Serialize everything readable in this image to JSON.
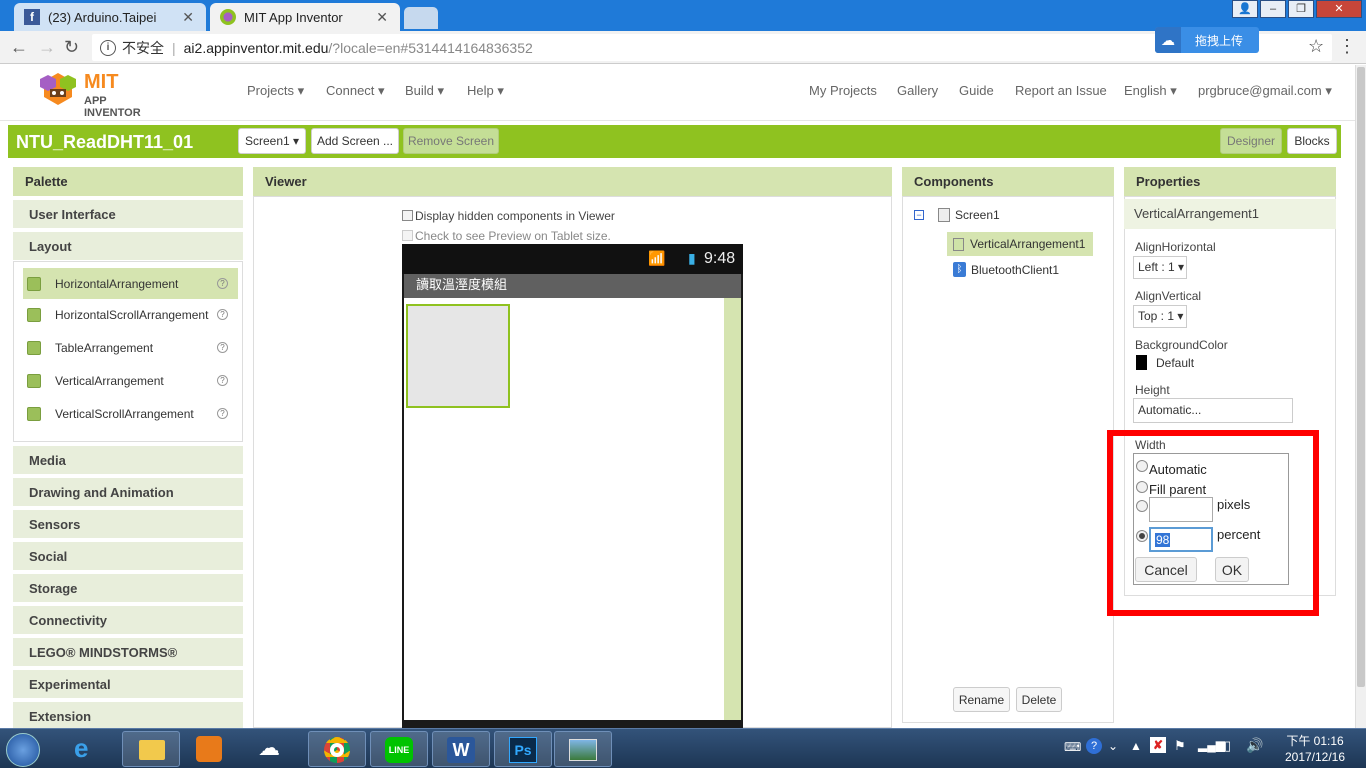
{
  "browser": {
    "tabs": [
      {
        "title": "(23) Arduino.Taipei"
      },
      {
        "title": "MIT App Inventor"
      }
    ],
    "insecure_label": "不安全",
    "url_host": "ai2.appinventor.mit.edu",
    "url_path": "/?locale=en#5314414164836352",
    "upload_button": "拖拽上传"
  },
  "topnav": {
    "logo_mit": "MIT",
    "logo_sub": "APP INVENTOR",
    "left_menu": [
      "Projects ▾",
      "Connect ▾",
      "Build ▾",
      "Help ▾"
    ],
    "right_menu": [
      "My Projects",
      "Gallery",
      "Guide",
      "Report an Issue",
      "English ▾",
      "prgbruce@gmail.com ▾"
    ]
  },
  "projectbar": {
    "name": "NTU_ReadDHT11_01",
    "screen_dropdown": "Screen1 ▾",
    "add_screen": "Add Screen ...",
    "remove_screen": "Remove Screen",
    "designer": "Designer",
    "blocks": "Blocks"
  },
  "palette": {
    "title": "Palette",
    "categories_top": [
      "User Interface",
      "Layout"
    ],
    "layout_items": [
      "HorizontalArrangement",
      "HorizontalScrollArrangement",
      "TableArrangement",
      "VerticalArrangement",
      "VerticalScrollArrangement"
    ],
    "categories_bottom": [
      "Media",
      "Drawing and Animation",
      "Sensors",
      "Social",
      "Storage",
      "Connectivity",
      "LEGO® MINDSTORMS®",
      "Experimental",
      "Extension"
    ]
  },
  "viewer": {
    "title": "Viewer",
    "display_hidden": "Display hidden components in Viewer",
    "tablet_preview": "Check to see Preview on Tablet size.",
    "phone_time": "9:48",
    "phone_title": "讀取溫溼度模組"
  },
  "components": {
    "title": "Components",
    "tree": [
      "Screen1",
      "VerticalArrangement1",
      "BluetoothClient1"
    ],
    "rename": "Rename",
    "delete": "Delete"
  },
  "properties": {
    "title": "Properties",
    "component": "VerticalArrangement1",
    "align_horizontal_label": "AlignHorizontal",
    "align_horizontal_value": "Left : 1 ▾",
    "align_vertical_label": "AlignVertical",
    "align_vertical_value": "Top : 1 ▾",
    "bg_color_label": "BackgroundColor",
    "bg_color_value": "Default",
    "height_label": "Height",
    "height_value": "Automatic...",
    "width_label": "Width"
  },
  "width_popup": {
    "automatic": "Automatic",
    "fill_parent": "Fill parent",
    "pixels": "pixels",
    "percent": "percent",
    "percent_value": "98",
    "selected_option": "percent",
    "cancel": "Cancel",
    "ok": "OK"
  },
  "taskbar": {
    "time": "下午 01:16",
    "date": "2017/12/16"
  },
  "colors": {
    "brand_green": "#8fc220",
    "panel_header": "#d5e4b0",
    "highlight_red": "#ff0000"
  }
}
